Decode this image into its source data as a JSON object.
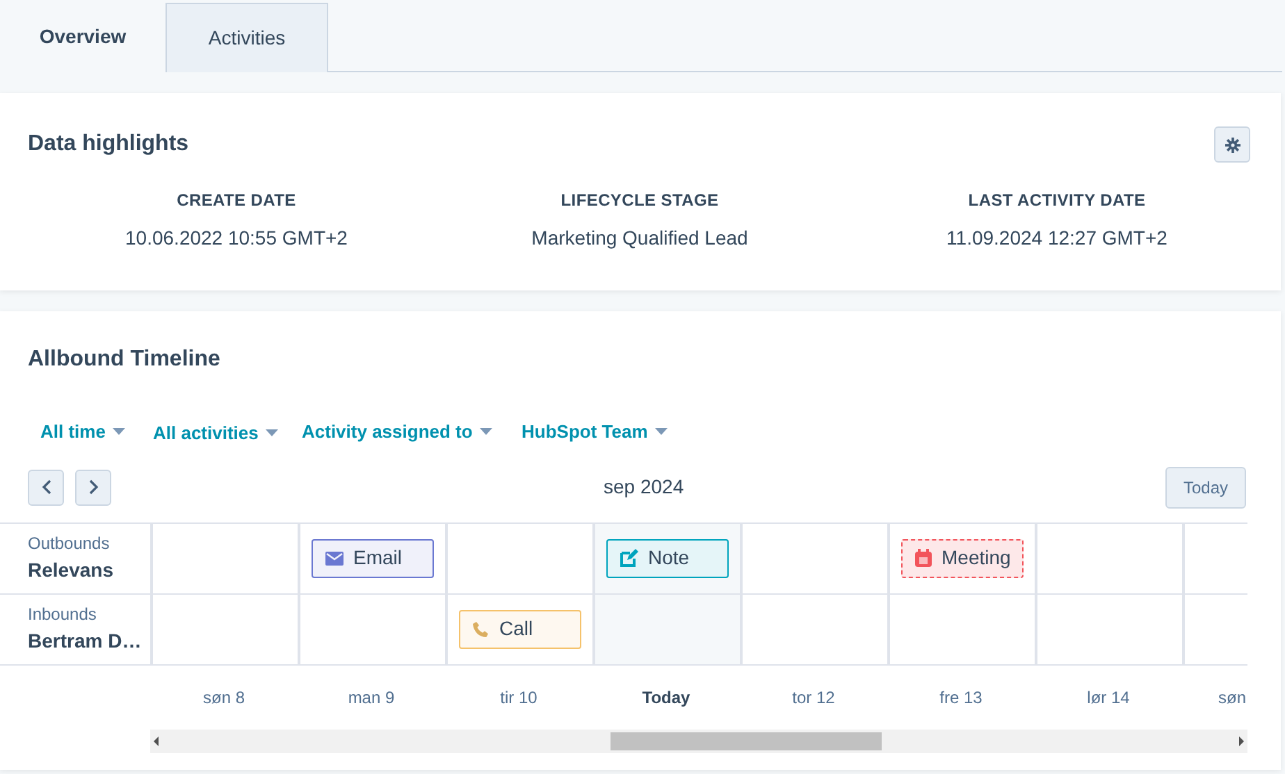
{
  "tabs": [
    {
      "label": "Overview",
      "selected": true
    },
    {
      "label": "Activities",
      "selected": false
    }
  ],
  "highlights": {
    "title": "Data highlights",
    "fields": [
      {
        "label": "CREATE DATE",
        "value": "10.06.2022 10:55 GMT+2"
      },
      {
        "label": "LIFECYCLE STAGE",
        "value": "Marketing Qualified Lead"
      },
      {
        "label": "LAST ACTIVITY DATE",
        "value": "11.09.2024 12:27 GMT+2"
      }
    ]
  },
  "timeline": {
    "title": "Allbound Timeline",
    "filters": [
      "All time",
      "All activities",
      "Activity assigned to",
      "HubSpot Team"
    ],
    "month": "sep 2024",
    "today_button": "Today",
    "rows": [
      {
        "group": "Outbounds",
        "name": "Relevans",
        "cells": [
          {
            "kind": "empty"
          },
          {
            "kind": "email",
            "label": "Email"
          },
          {
            "kind": "empty"
          },
          {
            "kind": "note",
            "label": "Note"
          },
          {
            "kind": "empty"
          },
          {
            "kind": "meeting",
            "label": "Meeting"
          },
          {
            "kind": "empty"
          },
          {
            "kind": "empty"
          }
        ]
      },
      {
        "group": "Inbounds",
        "name": "Bertram D…",
        "cells": [
          {
            "kind": "empty"
          },
          {
            "kind": "empty"
          },
          {
            "kind": "call",
            "label": "Call"
          },
          {
            "kind": "empty"
          },
          {
            "kind": "empty"
          },
          {
            "kind": "empty"
          },
          {
            "kind": "empty"
          },
          {
            "kind": "empty"
          }
        ]
      }
    ],
    "days": [
      {
        "label": "søn 8",
        "today": false
      },
      {
        "label": "man 9",
        "today": false
      },
      {
        "label": "tir 10",
        "today": false
      },
      {
        "label": "Today",
        "today": true
      },
      {
        "label": "tor 12",
        "today": false
      },
      {
        "label": "fre 13",
        "today": false
      },
      {
        "label": "lør 14",
        "today": false
      },
      {
        "label": "søn",
        "today": false
      }
    ]
  }
}
